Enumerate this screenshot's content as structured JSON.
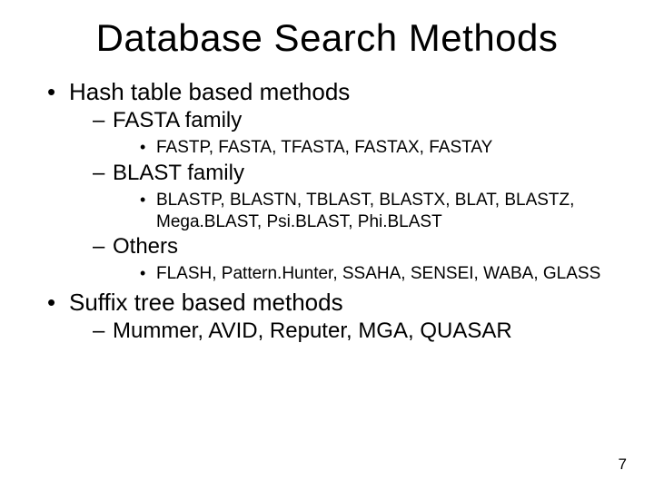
{
  "title": "Database Search Methods",
  "bullets": {
    "hash_heading": "Hash table based methods",
    "fasta_family": "FASTA family",
    "fasta_items": "FASTP, FASTA, TFASTA, FASTAX, FASTAY",
    "blast_family": "BLAST family",
    "blast_items": "BLASTP, BLASTN, TBLAST, BLASTX, BLAT, BLASTZ, Mega.BLAST, Psi.BLAST, Phi.BLAST",
    "others": "Others",
    "others_items": "FLASH, Pattern.Hunter, SSAHA, SENSEI, WABA, GLASS",
    "suffix_heading": "Suffix tree based methods",
    "suffix_items": "Mummer, AVID, Reputer, MGA, QUASAR"
  },
  "page_number": "7"
}
